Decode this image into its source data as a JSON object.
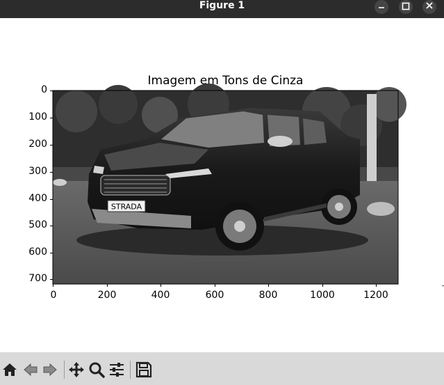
{
  "window": {
    "title": "Figure 1"
  },
  "window_controls": [
    "minimize",
    "maximize",
    "close"
  ],
  "figure": {
    "title": "Imagem em Tons de Cinza",
    "image_alt": "grayscale photo of a pickup truck with a STRADA license plate",
    "license_plate_text": "STRADA",
    "y_ticks": [
      "0",
      "100",
      "200",
      "300",
      "400",
      "500",
      "600",
      "700"
    ],
    "x_ticks": [
      "0",
      "200",
      "400",
      "600",
      "800",
      "1000",
      "1200"
    ]
  },
  "toolbar": {
    "items": [
      "home-icon",
      "back-icon",
      "forward-icon",
      "pan-icon",
      "zoom-icon",
      "configure-subplots-icon",
      "save-icon"
    ]
  }
}
